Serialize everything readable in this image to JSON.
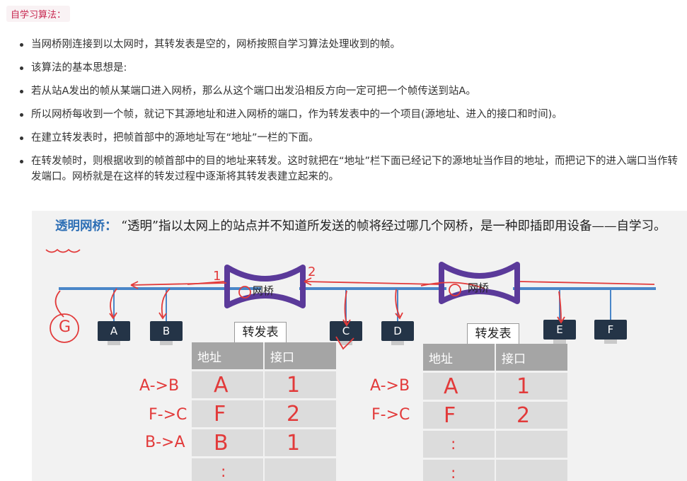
{
  "heading": "自学习算法：",
  "bullets": [
    "当网桥刚连接到以太网时，其转发表是空的，网桥按照自学习算法处理收到的帧。",
    "该算法的基本思想是:",
    "若从站A发出的帧从某端口进入网桥，那么从这个端口出发沿相反方向一定可把一个帧传送到站A。",
    "所以网桥每收到一个帧，就记下其源地址和进入网桥的端口，作为转发表中的一个项目(源地址、进入的接口和时间)。",
    "在建立转发表时，把帧首部中的源地址写在“地址”一栏的下面。",
    "在转发帧时，则根据收到的帧首部中的目的地址来转发。这时就把在“地址”栏下面已经记下的源地址当作目的地址，而把记下的进入端口当作转发端口。网桥就是在这样的转发过程中逐渐将其转发表建立起来的。"
  ],
  "slide": {
    "title_keyword": "透明网桥：",
    "title_text": "“透明”指以太网上的站点并不知道所发送的帧将经过哪几个网桥，是一种即插即用设备——自学习。",
    "bridges": [
      "网桥",
      "网桥"
    ],
    "stations": [
      "A",
      "B",
      "C",
      "D",
      "E",
      "F"
    ],
    "tables": [
      {
        "title": "转发表",
        "headers": [
          "地址",
          "接口"
        ],
        "annotations": [
          "A->B",
          "F->C",
          "B->A"
        ],
        "rows": [
          [
            "A",
            "1"
          ],
          [
            "F",
            "2"
          ],
          [
            "B",
            "1"
          ],
          [
            ":",
            ""
          ]
        ]
      },
      {
        "title": "转发表",
        "headers": [
          "地址",
          "接口"
        ],
        "annotations": [
          "A->B",
          "F->C"
        ],
        "rows": [
          [
            "A",
            "1"
          ],
          [
            "F",
            "2"
          ],
          [
            ":",
            ""
          ],
          [
            ":",
            ""
          ]
        ]
      }
    ],
    "handwriting": {
      "g_label": "G",
      "port1": "1",
      "port2": "2"
    },
    "colors": {
      "ink": "#e23a3a",
      "bus": "#4a86c8",
      "bridge": "#5b3a9a",
      "station": "#243447"
    }
  }
}
